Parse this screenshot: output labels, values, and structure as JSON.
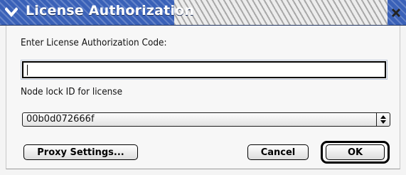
{
  "window": {
    "title": "License Authorization"
  },
  "form": {
    "auth_code_label": "Enter License Authorization Code:",
    "auth_code_value": "",
    "node_lock_label": "Node lock ID for license",
    "node_lock_value": "00b0d072666f"
  },
  "buttons": {
    "proxy_label": "Proxy Settings...",
    "cancel_label": "Cancel",
    "ok_label": "OK"
  },
  "colors": {
    "titlebar": "#3a61b8",
    "title_text": "#ffffff"
  },
  "icons": {
    "collapse": "chevron-down-icon",
    "close": "close-icon",
    "select_arrows": "up-down-arrows-icon"
  }
}
